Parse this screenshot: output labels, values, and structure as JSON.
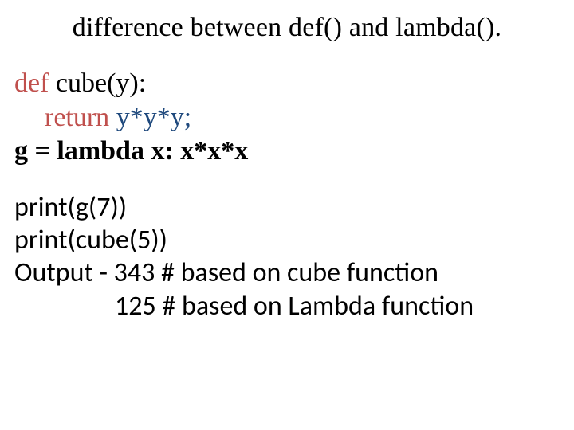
{
  "title": "difference between def() and lambda().",
  "code": {
    "def_kw": "def",
    "def_rest": " cube(y):",
    "return_kw": "return",
    "return_body": " y*y*y;",
    "lambda_line": "g = lambda x: x*x*x"
  },
  "calls": {
    "line1": "print(g(7))",
    "line2": "print(cube(5))",
    "line3": "Output - 343 # based on cube function",
    "line4": "125 # based on Lambda function"
  }
}
